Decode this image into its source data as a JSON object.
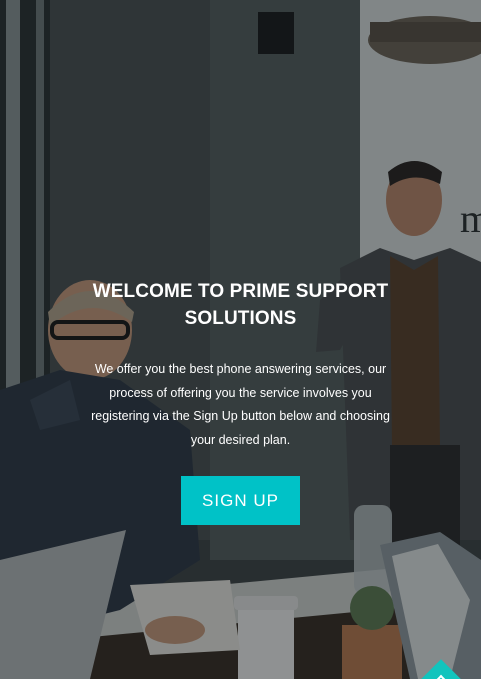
{
  "hero": {
    "title": "WELCOME TO PRIME SUPPORT SOLUTIONS",
    "description": "We offer you the best phone answering services, our process of offering you the service involves you registering via the Sign Up button below and choosing your desired plan.",
    "signup_label": "SIGN UP",
    "accent_color": "#00c2c7"
  },
  "background": {
    "photo_subject": "office-meeting-photo",
    "wall_lettering": "m"
  },
  "scroll_top": {
    "icon": "chevron-up-icon"
  }
}
